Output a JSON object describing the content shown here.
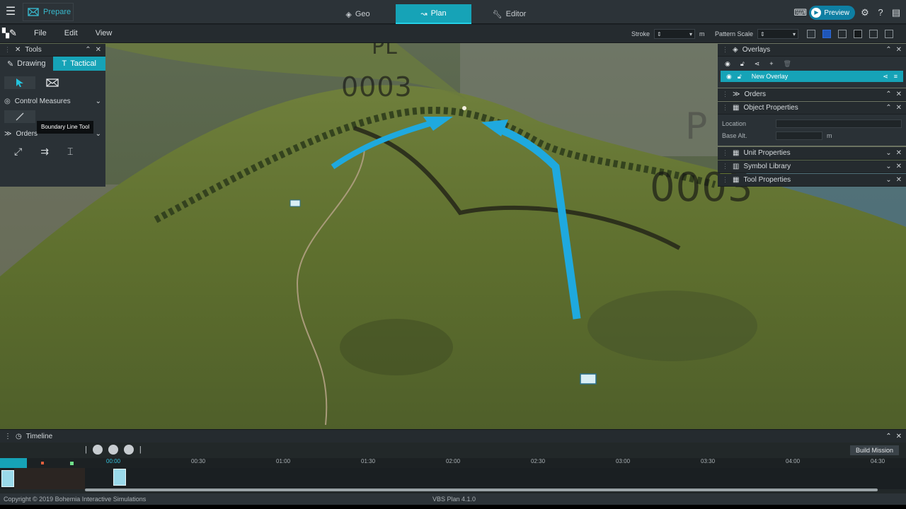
{
  "topbar": {
    "prepare_label": "Prepare",
    "tabs": [
      {
        "label": "Geo",
        "icon": "layers-icon",
        "active": false
      },
      {
        "label": "Plan",
        "icon": "route-icon",
        "active": true
      },
      {
        "label": "Editor",
        "icon": "wrench-icon",
        "active": false
      }
    ],
    "preview_label": "Preview",
    "accent_color": "#16a3b7"
  },
  "menubar": {
    "items": [
      "File",
      "Edit",
      "View"
    ],
    "stroke_label": "Stroke",
    "stroke_unit": "m",
    "pattern_scale_label": "Pattern Scale"
  },
  "map": {
    "labels": [
      "0003",
      "0003",
      "PL",
      "P"
    ],
    "arrow_color": "#1fa9de"
  },
  "tools_panel": {
    "title": "Tools",
    "tabs": [
      {
        "label": "Drawing",
        "active": false
      },
      {
        "label": "Tactical",
        "active": true
      }
    ],
    "control_measures_label": "Control Measures",
    "tooltip": "Boundary Line Tool",
    "orders_label": "Orders"
  },
  "right_panels": {
    "overlays_title": "Overlays",
    "overlay_item": "New Overlay",
    "orders_title": "Orders",
    "object_properties_title": "Object Properties",
    "location_label": "Location",
    "base_alt_label": "Base Alt.",
    "base_alt_unit": "m",
    "unit_properties_title": "Unit Properties",
    "symbol_library_title": "Symbol Library",
    "tool_properties_title": "Tool Properties"
  },
  "timeline": {
    "title": "Timeline",
    "build_label": "Build Mission",
    "ticks": [
      "00:00",
      "00:30",
      "01:00",
      "01:30",
      "02:00",
      "02:30",
      "03:00",
      "03:30",
      "04:00",
      "04:30"
    ]
  },
  "status": {
    "copyright": "Copyright © 2019 Bohemia Interactive Simulations",
    "version": "VBS Plan 4.1.0"
  }
}
